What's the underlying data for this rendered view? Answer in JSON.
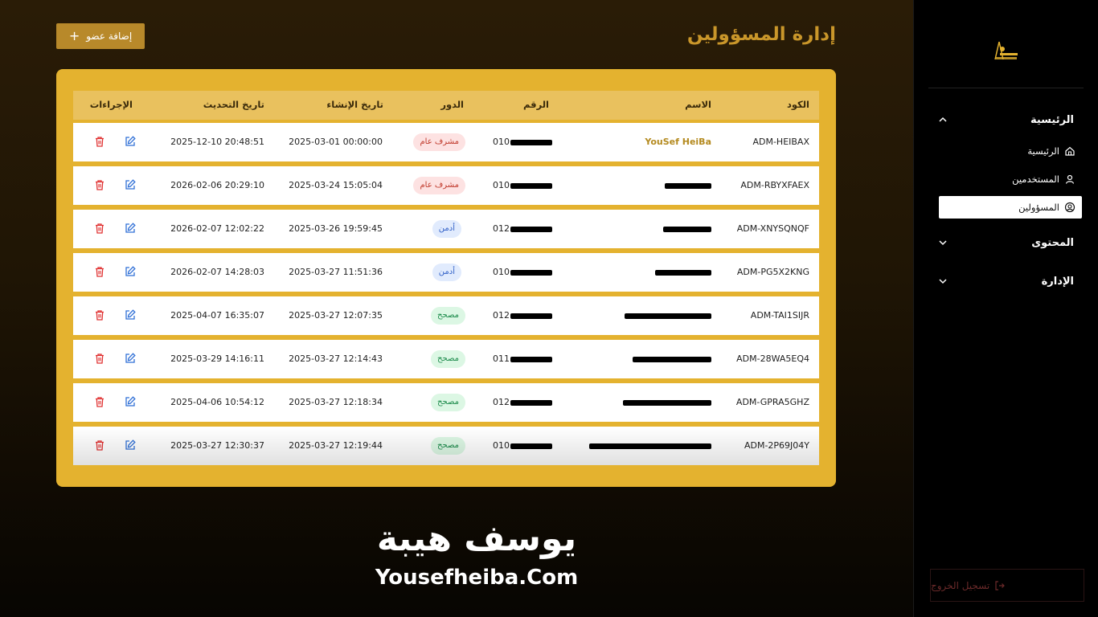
{
  "page": {
    "title": "إدارة المسؤولين",
    "add_button": "إضافة عضو"
  },
  "sidebar": {
    "sections": [
      {
        "label": "الرئيسية",
        "expanded": true
      },
      {
        "label": "المحتوى",
        "expanded": false
      },
      {
        "label": "الإدارة",
        "expanded": false
      }
    ],
    "items": [
      {
        "label": "الرئيسية",
        "icon": "home-icon"
      },
      {
        "label": "المستخدمين",
        "icon": "user-icon"
      },
      {
        "label": "المسؤولين",
        "icon": "user-circle-icon",
        "active": true
      }
    ],
    "logout": "تسجيل الخروج"
  },
  "table": {
    "headers": {
      "code": "الكود",
      "name": "الاسم",
      "phone": "الرقم",
      "role": "الدور",
      "created": "تاريخ الإنشاء",
      "updated": "تاريخ التحديث",
      "actions": "الإجراءات"
    },
    "rows": [
      {
        "code": "ADM-HEIBAX",
        "name": "YouSef HeiBa",
        "phone": "010",
        "role": "مشرف عام",
        "role_color": "red",
        "created": "2025-03-01 00:00:00",
        "updated": "2025-12-10 20:48:51"
      },
      {
        "code": "ADM-RBYXFAEX",
        "name": "",
        "phone": "010",
        "role": "مشرف عام",
        "role_color": "red",
        "created": "2025-03-24 15:05:04",
        "updated": "2026-02-06 20:29:10"
      },
      {
        "code": "ADM-XNYSQNQF",
        "name": "",
        "phone": "012",
        "role": "أدمن",
        "role_color": "blue",
        "created": "2025-03-26 19:59:45",
        "updated": "2026-02-07 12:02:22"
      },
      {
        "code": "ADM-PG5X2KNG",
        "name": "",
        "phone": "010",
        "role": "أدمن",
        "role_color": "blue",
        "created": "2025-03-27 11:51:36",
        "updated": "2026-02-07 14:28:03"
      },
      {
        "code": "ADM-TAI1SIJR",
        "name": "",
        "phone": "012",
        "role": "مصحح",
        "role_color": "green",
        "created": "2025-03-27 12:07:35",
        "updated": "2025-04-07 16:35:07"
      },
      {
        "code": "ADM-28WA5EQ4",
        "name": "",
        "phone": "011",
        "role": "مصحح",
        "role_color": "green",
        "created": "2025-03-27 12:14:43",
        "updated": "2025-03-29 14:16:11"
      },
      {
        "code": "ADM-GPRA5GHZ",
        "name": "",
        "phone": "012",
        "role": "مصحح",
        "role_color": "green",
        "created": "2025-03-27 12:18:34",
        "updated": "2025-04-06 10:54:12"
      },
      {
        "code": "ADM-2P69J04Y",
        "name": "",
        "phone": "010",
        "role": "مصحح",
        "role_color": "green",
        "created": "2025-03-27 12:19:44",
        "updated": "2025-03-27 12:30:37"
      }
    ]
  },
  "watermark": {
    "arabic": "يوسف هيبة",
    "english": "Yousefheiba.Com"
  },
  "colors": {
    "accent": "#e4b22f",
    "title": "#c9962a",
    "button": "#b8892a"
  }
}
